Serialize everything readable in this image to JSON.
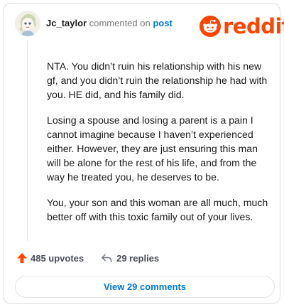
{
  "header": {
    "username": "Jc_taylor",
    "action_text": "commented on",
    "target_text": "post"
  },
  "brand": {
    "wordmark": "reddit",
    "color": "#ff4500",
    "icon": "reddit-snoo-icon"
  },
  "comment": {
    "paragraphs": [
      "NTA. You didn’t ruin his relationship with his new gf, and you didn’t ruin the relationship he had with you. HE did, and his family did.",
      "Losing a spouse and losing a parent is a pain I cannot imagine because I haven’t experienced either. However, they are just ensuring this man will be alone for the rest of his life, and from the way he treated you, he deserves to be.",
      "You, your son and this woman are all much, much better off with this toxic family out of your lives."
    ]
  },
  "stats": {
    "upvotes": "485 upvotes",
    "upvote_icon": "upvote-arrow-icon",
    "replies": "29 replies",
    "reply_icon": "reply-arrow-icon"
  },
  "footer": {
    "view_button": "View 29 comments"
  },
  "colors": {
    "link": "#0079d3",
    "upvote": "#ff4500",
    "text": "#1a1a1b",
    "muted": "#7c7c7c",
    "border": "#d9dcdf"
  }
}
